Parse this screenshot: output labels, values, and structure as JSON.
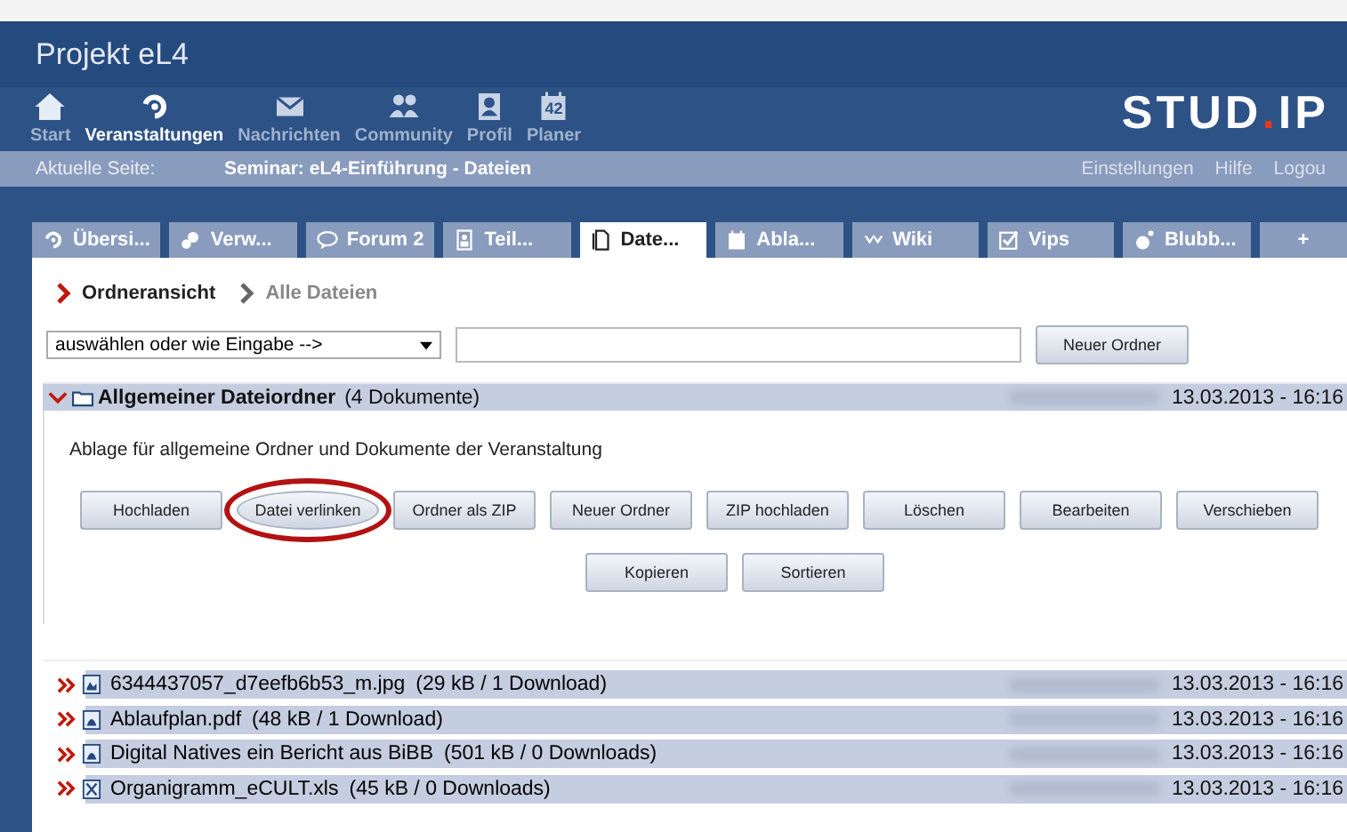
{
  "header": {
    "title": "Projekt eL4",
    "logo": {
      "main": "STUD",
      "dot": ".",
      "tail": "IP"
    }
  },
  "nav": [
    {
      "label": "Start",
      "selected": false
    },
    {
      "label": "Veranstaltungen",
      "selected": true
    },
    {
      "label": "Nachrichten",
      "selected": false
    },
    {
      "label": "Community",
      "selected": false
    },
    {
      "label": "Profil",
      "selected": false
    },
    {
      "label": "Planer",
      "badge": "42",
      "selected": false
    }
  ],
  "breadcrumb": {
    "label": "Aktuelle Seite:",
    "page": "Seminar: eL4-Einführung - Dateien",
    "links": [
      "Einstellungen",
      "Hilfe",
      "Logou"
    ]
  },
  "tabs": [
    {
      "label": "Übersi...",
      "selected": false
    },
    {
      "label": "Verw...",
      "selected": false
    },
    {
      "label": "Forum 2",
      "selected": false
    },
    {
      "label": "Teil...",
      "selected": false
    },
    {
      "label": "Date...",
      "selected": true
    },
    {
      "label": "Abla...",
      "selected": false
    },
    {
      "label": "Wiki",
      "selected": false
    },
    {
      "label": "Vips",
      "selected": false
    },
    {
      "label": "Blubb...",
      "selected": false
    },
    {
      "label": "+",
      "selected": false
    }
  ],
  "subnav": [
    {
      "label": "Ordneransicht",
      "selected": true
    },
    {
      "label": "Alle Dateien",
      "selected": false
    }
  ],
  "folder_form": {
    "select": "auswählen oder wie Eingabe -->",
    "button": "Neuer Ordner"
  },
  "folder": {
    "name": "Allgemeiner Dateiordner",
    "count": "(4 Dokumente)",
    "date": "13.03.2013 - 16:16",
    "expanded": true,
    "description": "Ablage für allgemeine Ordner und Dokumente der Veranstaltung",
    "buttons": [
      {
        "label": "Hochladen",
        "highlighted": false
      },
      {
        "label": "Datei verlinken",
        "highlighted": true
      },
      {
        "label": "Ordner als ZIP",
        "highlighted": false
      },
      {
        "label": "Neuer Ordner",
        "highlighted": false
      },
      {
        "label": "ZIP hochladen",
        "highlighted": false
      },
      {
        "label": "Löschen",
        "highlighted": false
      },
      {
        "label": "Bearbeiten",
        "highlighted": false
      },
      {
        "label": "Verschieben",
        "highlighted": false
      },
      {
        "label": "Kopieren",
        "highlighted": false
      },
      {
        "label": "Sortieren",
        "highlighted": false
      }
    ]
  },
  "files": [
    {
      "name": "6344437057_d7eefb6b53_m.jpg",
      "info": "(29 kB / 1 Download)",
      "date": "13.03.2013 - 16:16",
      "kind": "image"
    },
    {
      "name": "Ablaufplan.pdf",
      "info": "(48 kB / 1 Download)",
      "date": "13.03.2013 - 16:16",
      "kind": "pdf"
    },
    {
      "name": "Digital Natives ein Bericht aus BiBB",
      "info": "(501 kB / 0 Downloads)",
      "date": "13.03.2013 - 16:16",
      "kind": "pdf"
    },
    {
      "name": "Organigramm_eCULT.xls",
      "info": "(45 kB / 0 Downloads)",
      "date": "13.03.2013 - 16:16",
      "kind": "sheet"
    }
  ]
}
